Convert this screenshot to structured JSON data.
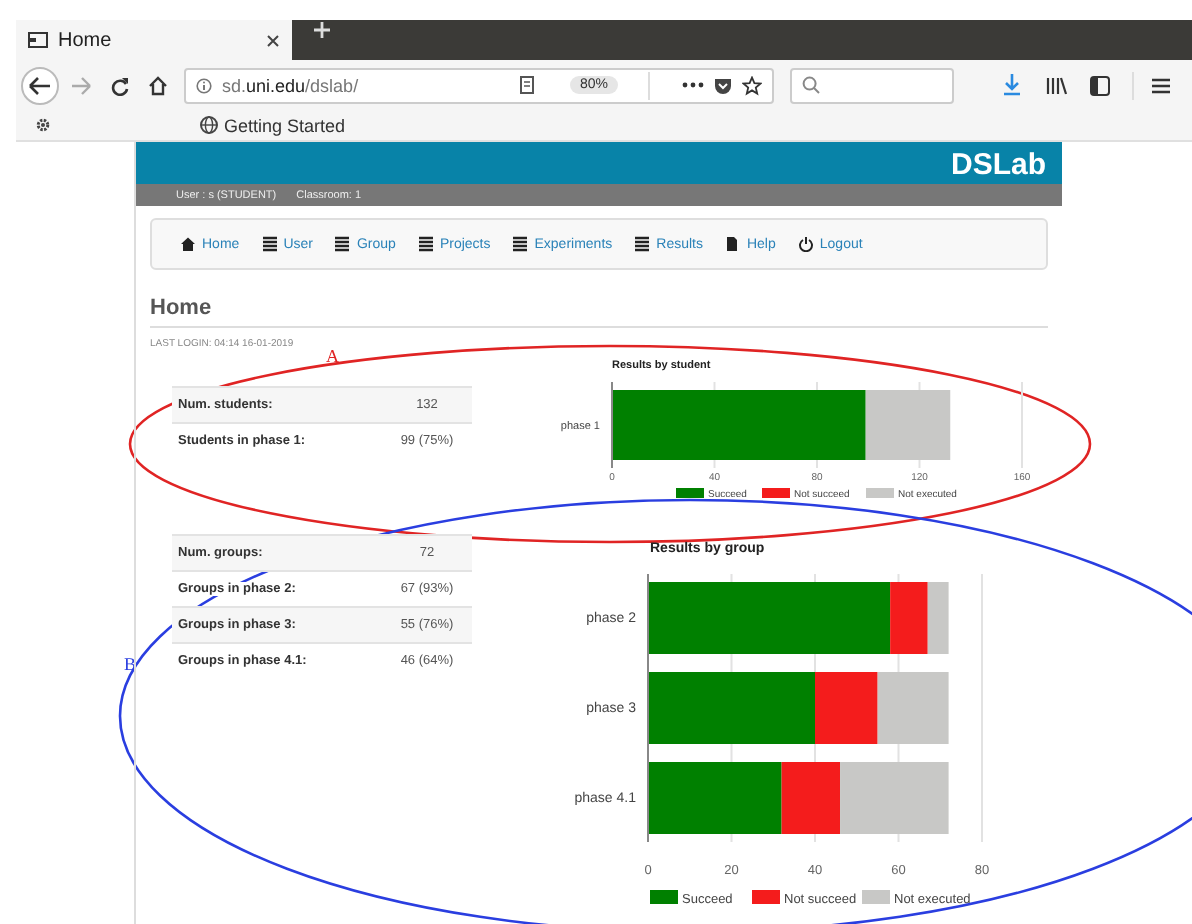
{
  "browser": {
    "tab": {
      "title": "Home"
    },
    "url": {
      "prefix": "sd.",
      "domain": "uni.edu",
      "path": "/dslab/"
    },
    "zoom": "80%",
    "bookmarks": [
      {
        "label": "Getting Started"
      }
    ]
  },
  "header": {
    "brand": "DSLab",
    "user": "User :  s (STUDENT)",
    "classroom": "Classroom:  1"
  },
  "nav": [
    {
      "label": "Home",
      "kind": "home"
    },
    {
      "label": "User",
      "kind": "list"
    },
    {
      "label": "Group",
      "kind": "list"
    },
    {
      "label": "Projects",
      "kind": "list"
    },
    {
      "label": "Experiments",
      "kind": "list"
    },
    {
      "label": "Results",
      "kind": "list"
    },
    {
      "label": "Help",
      "kind": "file"
    },
    {
      "label": "Logout",
      "kind": "power"
    }
  ],
  "page_title": "Home",
  "last_login": "LAST LOGIN: 04:14  16-01-2019",
  "annotations": [
    {
      "label": "A",
      "color": "#e02424"
    },
    {
      "label": "B",
      "color": "#2a3ee0"
    }
  ],
  "student_stats": [
    {
      "label": "Num. students:",
      "value": "132"
    },
    {
      "label": "Students in phase 1:",
      "value": "99 (75%)"
    }
  ],
  "student_chart": {
    "chart_data": {
      "type": "bar",
      "orientation": "horizontal",
      "stacked": true,
      "title": "Results by student",
      "categories": [
        "phase 1"
      ],
      "series": [
        {
          "name": "Succeed",
          "color": "#008000",
          "values": [
            99
          ]
        },
        {
          "name": "Not succeed",
          "color": "#f41c1c",
          "values": [
            0
          ]
        },
        {
          "name": "Not executed",
          "color": "#c8c8c6",
          "values": [
            33
          ]
        }
      ],
      "grid": true,
      "legend": true,
      "xlim": [
        0,
        160
      ],
      "xticks": [
        0,
        40,
        80,
        120,
        160
      ]
    }
  },
  "group_stats": [
    {
      "label": "Num. groups:",
      "value": "72"
    },
    {
      "label": "Groups in phase 2:",
      "value": "67 (93%)"
    },
    {
      "label": "Groups in phase 3:",
      "value": "55 (76%)"
    },
    {
      "label": "Groups in phase 4.1:",
      "value": "46 (64%)"
    }
  ],
  "group_chart": {
    "chart_data": {
      "type": "bar",
      "orientation": "horizontal",
      "stacked": true,
      "title": "Results by group",
      "categories": [
        "phase 2",
        "phase 3",
        "phase 4.1"
      ],
      "series": [
        {
          "name": "Succeed",
          "color": "#008000",
          "values": [
            58,
            40,
            32
          ]
        },
        {
          "name": "Not succeed",
          "color": "#f41c1c",
          "values": [
            9,
            15,
            14
          ]
        },
        {
          "name": "Not executed",
          "color": "#c8c8c6",
          "values": [
            5,
            17,
            26
          ]
        }
      ],
      "grid": true,
      "legend": true,
      "xlim": [
        0,
        80
      ],
      "xticks": [
        0,
        20,
        40,
        60,
        80
      ]
    }
  }
}
